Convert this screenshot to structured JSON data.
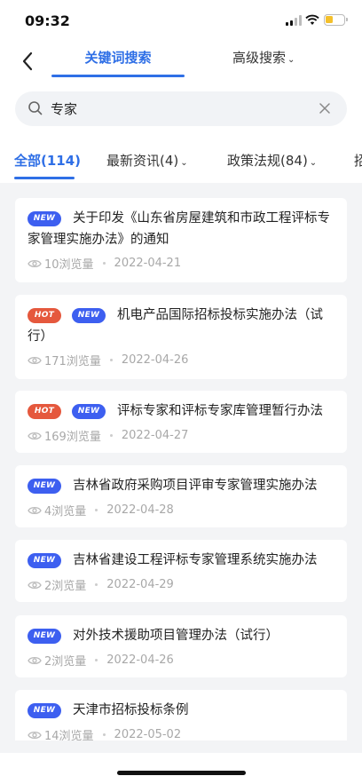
{
  "status_bar": {
    "time": "09:32",
    "signal_icon": "signal-icon",
    "wifi_icon": "wifi-icon",
    "battery_icon": "battery-icon"
  },
  "nav": {
    "back_icon": "chevron-left-icon",
    "tab_keyword": "关键词搜索",
    "tab_advanced": "高级搜索",
    "tab_advanced_chevron": "⌄"
  },
  "search": {
    "value": "专家",
    "icon": "search-icon",
    "clear_icon": "close-icon"
  },
  "categories": [
    {
      "label": "全部(114)",
      "active": true
    },
    {
      "label": "最新资讯(4)",
      "chevron": "⌄"
    },
    {
      "label": "政策法规(84)",
      "chevron": "⌄"
    },
    {
      "label": "招"
    }
  ],
  "accent_color": "#2f6fe6",
  "badges": {
    "new": "NEW",
    "hot": "HOT"
  },
  "items": [
    {
      "badges": [
        "NEW"
      ],
      "title": "关于印发《山东省房屋建筑和市政工程评标专家管理实施办法》的通知",
      "views": "10浏览量",
      "date": "2022-04-21"
    },
    {
      "badges": [
        "HOT",
        "NEW"
      ],
      "title": "机电产品国际招标投标实施办法（试行）",
      "views": "171浏览量",
      "date": "2022-04-26"
    },
    {
      "badges": [
        "HOT",
        "NEW"
      ],
      "title": "评标专家和评标专家库管理暂行办法",
      "views": "169浏览量",
      "date": "2022-04-27"
    },
    {
      "badges": [
        "NEW"
      ],
      "title": "吉林省政府采购项目评审专家管理实施办法",
      "views": "4浏览量",
      "date": "2022-04-28"
    },
    {
      "badges": [
        "NEW"
      ],
      "title": "吉林省建设工程评标专家管理系统实施办法",
      "views": "2浏览量",
      "date": "2022-04-29"
    },
    {
      "badges": [
        "NEW"
      ],
      "title": "对外技术援助项目管理办法（试行）",
      "views": "2浏览量",
      "date": "2022-04-26"
    },
    {
      "badges": [
        "NEW"
      ],
      "title": "天津市招标投标条例",
      "views": "14浏览量",
      "date": "2022-05-02"
    }
  ]
}
